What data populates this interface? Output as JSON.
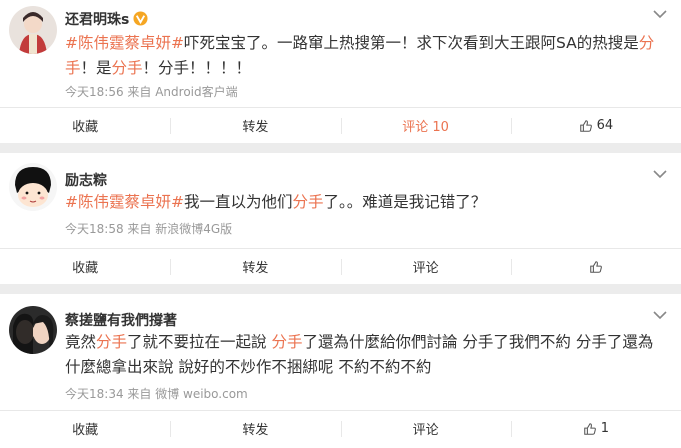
{
  "posts": [
    {
      "author": "还君明珠s",
      "vip_badge": true,
      "tag": "#陈伟霆蔡卓妍#",
      "text_segments": [
        {
          "t": "吓死宝宝了。一路窜上热搜第一！求下次看到大王跟阿SA的热搜是",
          "hl": false
        },
        {
          "t": "分手",
          "hl": true
        },
        {
          "t": "！是",
          "hl": false
        },
        {
          "t": "分手",
          "hl": true
        },
        {
          "t": "！分手！！！！",
          "hl": false
        }
      ],
      "meta": "今天18:56 来自 Android客户端",
      "actions": {
        "fav": "收藏",
        "repost": "转发",
        "comment": "评论 10",
        "like": "64"
      },
      "comment_active": true
    },
    {
      "author": "励志粽",
      "vip_badge": false,
      "tag": "#陈伟霆蔡卓妍#",
      "text_segments": [
        {
          "t": "我一直以为他们",
          "hl": false
        },
        {
          "t": "分手",
          "hl": true
        },
        {
          "t": "了。。难道是我记错了？",
          "hl": false
        }
      ],
      "meta": "今天18:58 来自 新浪微博4G版",
      "actions": {
        "fav": "收藏",
        "repost": "转发",
        "comment": "评论",
        "like": ""
      },
      "comment_active": false
    },
    {
      "author": "蔡搓鹽有我們撐著",
      "vip_badge": false,
      "tag": "",
      "text_segments": [
        {
          "t": "竟然",
          "hl": false
        },
        {
          "t": "分手",
          "hl": true
        },
        {
          "t": "了就不要拉在一起說 ",
          "hl": false
        },
        {
          "t": "分手",
          "hl": true
        },
        {
          "t": "了還為什麼給你們討論 分手了我們不約 分手了還為什麼總拿出來說 說好的不炒作不捆綁呢 不約不約不約",
          "hl": false
        }
      ],
      "meta": "今天18:34 来自 微博 weibo.com",
      "actions": {
        "fav": "收藏",
        "repost": "转发",
        "comment": "评论",
        "like": "1"
      },
      "comment_active": false
    }
  ],
  "colors": {
    "accent": "#eb7350",
    "text": "#333333",
    "meta": "#999999",
    "bg": "#ececec"
  }
}
